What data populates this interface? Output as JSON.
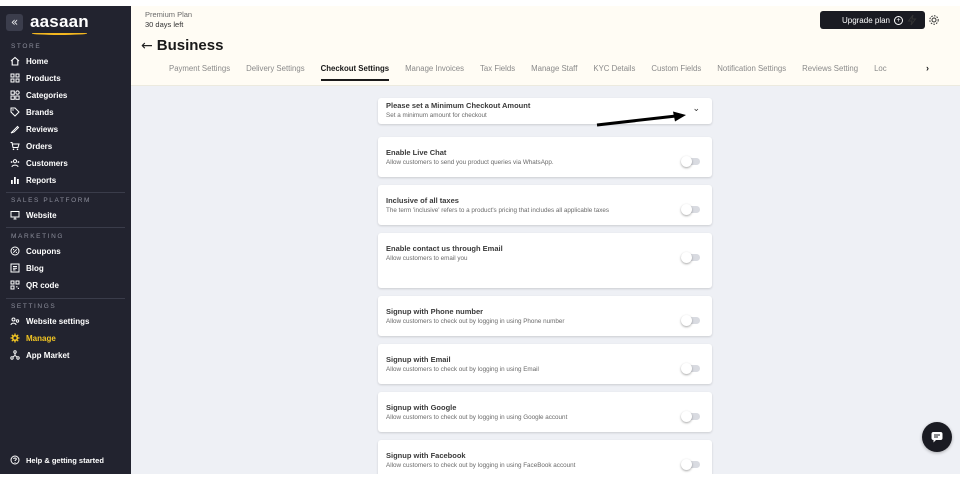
{
  "sidebar": {
    "collapse_icon": "chevrons-left-icon",
    "logo_text": "aasaan",
    "sections": {
      "store": "STORE",
      "sales_platform": "SALES PLATFORM",
      "marketing": "MARKETING",
      "settings": "SETTINGS"
    },
    "store_items": [
      {
        "label": "Home",
        "icon": "home-icon"
      },
      {
        "label": "Products",
        "icon": "grid-icon"
      },
      {
        "label": "Categories",
        "icon": "categories-icon"
      },
      {
        "label": "Brands",
        "icon": "tag-icon"
      },
      {
        "label": "Reviews",
        "icon": "review-icon"
      },
      {
        "label": "Orders",
        "icon": "cart-icon"
      },
      {
        "label": "Customers",
        "icon": "customers-icon"
      },
      {
        "label": "Reports",
        "icon": "bar-chart-icon"
      }
    ],
    "sales_items": [
      {
        "label": "Website",
        "icon": "monitor-icon"
      }
    ],
    "marketing_items": [
      {
        "label": "Coupons",
        "icon": "coupon-icon"
      },
      {
        "label": "Blog",
        "icon": "blog-icon"
      },
      {
        "label": "QR code",
        "icon": "qr-code-icon"
      }
    ],
    "settings_items": [
      {
        "label": "Website settings",
        "icon": "website-settings-icon"
      },
      {
        "label": "Manage",
        "icon": "gear-icon",
        "active": true
      },
      {
        "label": "App Market",
        "icon": "app-market-icon"
      }
    ],
    "help_label": "Help & getting started",
    "accent_color": "#f3c623"
  },
  "header": {
    "plan_name": "Premium Plan",
    "plan_days": "30 days left",
    "upgrade_label": "Upgrade plan",
    "back_icon": "arrow-left-icon",
    "title": "Business",
    "tabs": [
      {
        "label": "Payment Settings"
      },
      {
        "label": "Delivery Settings"
      },
      {
        "label": "Checkout Settings",
        "active": true
      },
      {
        "label": "Manage Invoices"
      },
      {
        "label": "Tax Fields"
      },
      {
        "label": "Manage Staff"
      },
      {
        "label": "KYC Details"
      },
      {
        "label": "Custom Fields"
      },
      {
        "label": "Notification Settings"
      },
      {
        "label": "Reviews Setting"
      },
      {
        "label": "Loc"
      }
    ]
  },
  "settings": [
    {
      "title": "Please set a Minimum Checkout Amount",
      "desc": "Set a minimum amount for checkout",
      "control": "chevron-down-icon"
    },
    {
      "title": "Enable Live Chat",
      "desc": "Allow customers to send you product queries via WhatsApp.",
      "enabled": false
    },
    {
      "title": "Inclusive of all taxes",
      "desc": "The term 'inclusive' refers to a product's pricing that includes all applicable taxes",
      "enabled": false
    },
    {
      "title": "Enable contact us through Email",
      "desc": "Allow customers to email you",
      "enabled": false
    },
    {
      "title": "Signup with Phone number",
      "desc": "Allow customers to check out by logging in using Phone number",
      "enabled": false
    },
    {
      "title": "Signup with Email",
      "desc": "Allow customers to check out by logging in using Email",
      "enabled": false
    },
    {
      "title": "Signup with Google",
      "desc": "Allow customers to check out by logging in using Google account",
      "enabled": false
    },
    {
      "title": "Signup with Facebook",
      "desc": "Allow customers to check out by logging in using FaceBook account",
      "enabled": false
    }
  ]
}
